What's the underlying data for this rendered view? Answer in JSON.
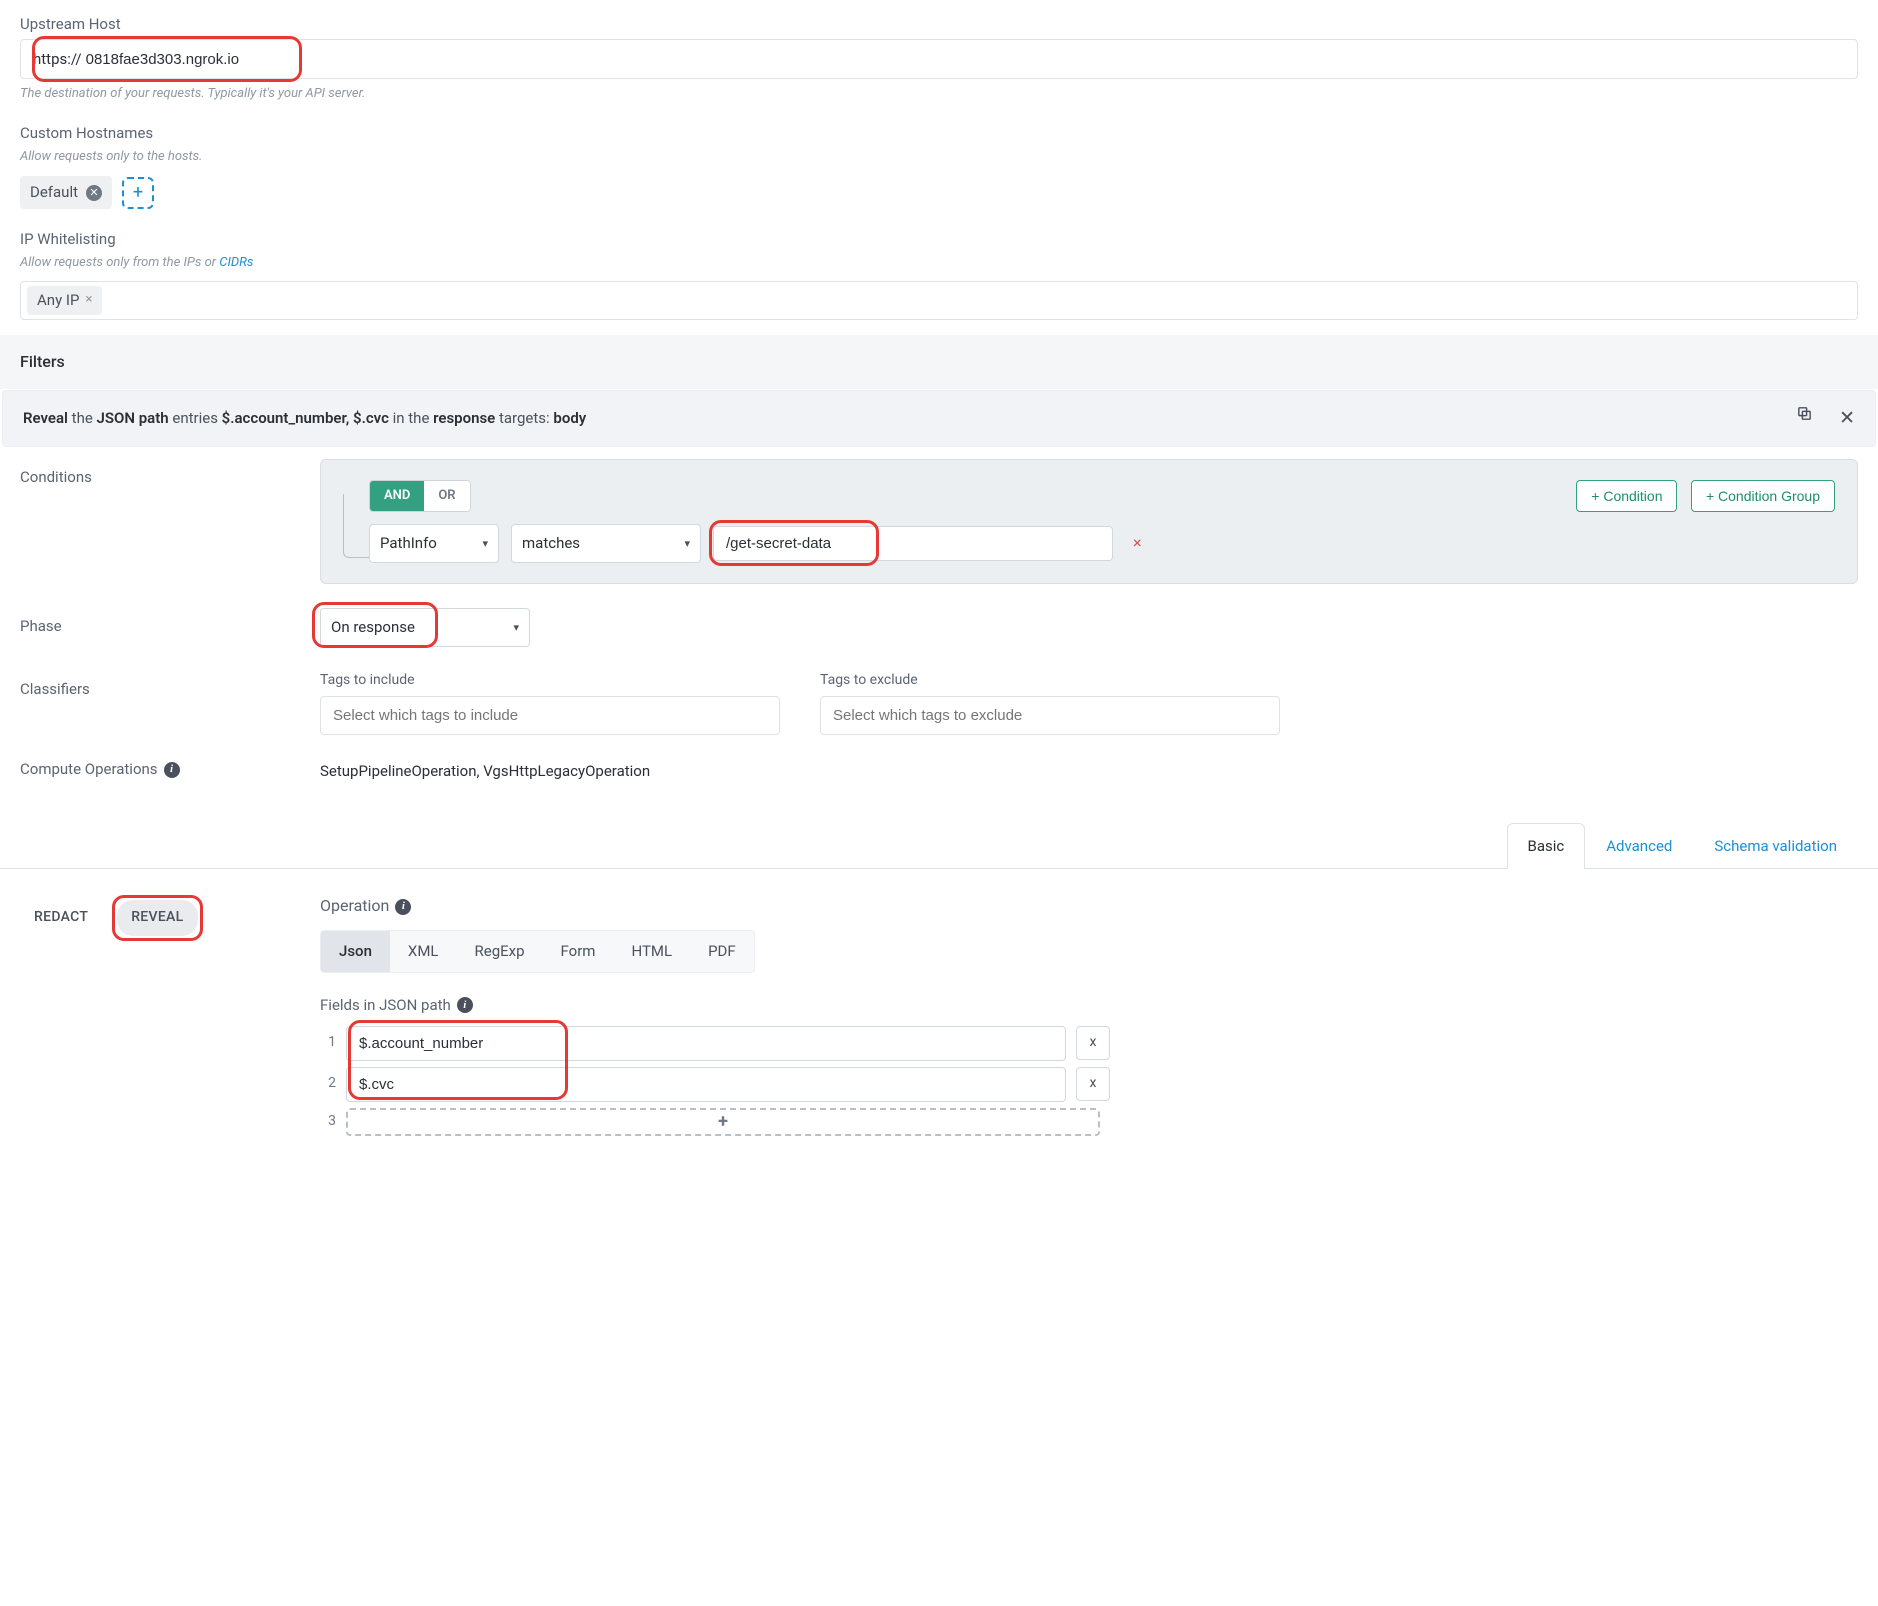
{
  "upstream": {
    "label": "Upstream Host",
    "prefix": "https://",
    "value": "0818fae3d303.ngrok.io",
    "hint": "The destination of your requests. Typically it's your API server."
  },
  "custom_hostnames": {
    "label": "Custom Hostnames",
    "hint": "Allow requests only to the hosts.",
    "chip": "Default"
  },
  "ip_whitelist": {
    "label": "IP Whitelisting",
    "hint_prefix": "Allow requests only from the IPs or ",
    "hint_link": "CIDRs",
    "tag": "Any IP"
  },
  "filters": {
    "title": "Filters",
    "summary": {
      "reveal": "Reveal",
      "the": " the ",
      "json_path": "JSON path",
      "entries": " entries ",
      "paths": "$.account_number, $.cvc",
      "in_the": " in the ",
      "response": "response",
      "targets": " targets: ",
      "body": "body"
    }
  },
  "conditions": {
    "label": "Conditions",
    "and": "AND",
    "or": "OR",
    "add_condition": "+ Condition",
    "add_group": "+ Condition Group",
    "field": "PathInfo",
    "operator": "matches",
    "value": "/get-secret-data"
  },
  "phase": {
    "label": "Phase",
    "value": "On response"
  },
  "classifiers": {
    "label": "Classifiers",
    "include_label": "Tags to include",
    "include_placeholder": "Select which tags to include",
    "exclude_label": "Tags to exclude",
    "exclude_placeholder": "Select which tags to exclude"
  },
  "compute": {
    "label": "Compute Operations",
    "value": "SetupPipelineOperation, VgsHttpLegacyOperation"
  },
  "tabs": {
    "basic": "Basic",
    "advanced": "Advanced",
    "schema": "Schema validation"
  },
  "rr": {
    "redact": "REDACT",
    "reveal": "REVEAL"
  },
  "operation": {
    "label": "Operation",
    "formats": [
      "Json",
      "XML",
      "RegExp",
      "Form",
      "HTML",
      "PDF"
    ]
  },
  "fields": {
    "label": "Fields in JSON path",
    "rows": [
      "$.account_number",
      "$.cvc"
    ],
    "row3_idx": "3",
    "del": "x",
    "add": "+"
  }
}
